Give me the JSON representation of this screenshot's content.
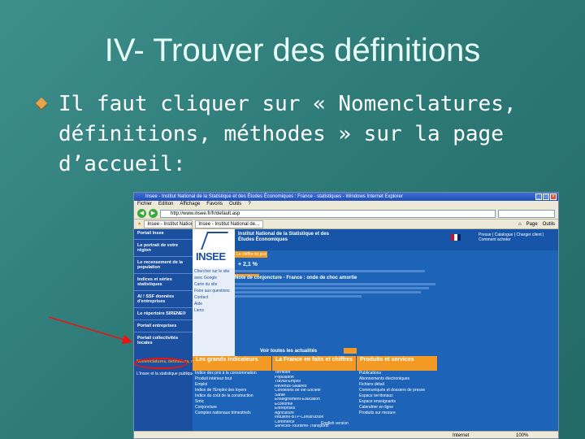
{
  "slide": {
    "title": "IV- Trouver des définitions",
    "bullet_text": "Il faut cliquer sur « Nomenclatures, définitions, méthodes » sur la page d’accueil:"
  },
  "browser": {
    "window_title": "Insee - Institut National de la Statistique et des Études Économiques : France - statistiques - Windows Internet Explorer",
    "menu": [
      "Fichier",
      "Edition",
      "Affichage",
      "Favoris",
      "Outils",
      "?"
    ],
    "url": "http://www.insee.fr/fr/default.asp",
    "tabs": [
      "Insee - Institut National de la...",
      "Insee - Institut National de..."
    ],
    "tools": [
      "Page",
      "Outils"
    ],
    "status_zone": "Internet",
    "zoom": "100%"
  },
  "site": {
    "logo": "INSEE",
    "institute_name": "Institut National de la Statistique et des Études Économiques",
    "chiffre_tag": "Le chiffre du jour",
    "value": "+ 2,1 %",
    "info_tag": "L'info du jour",
    "note_heading": "Note de conjoncture - France : onde de choc amortie",
    "voir_link": "Voir toutes les actualités",
    "voir_tag": "RSS",
    "left_nav": [
      "Portail Insee",
      "Le portrait de votre région",
      "Le recensement de la population",
      "Indices et séries statistiques",
      "Al ! SSF données d'entreprises",
      "Le répertoire SIRENE®",
      "Portail entreprises",
      "Portail collectivités locales"
    ],
    "search_col": [
      "Chercher sur le site",
      "avec Google",
      "Carte du site",
      "Foire aux questions",
      "Contact",
      "Aide",
      "Liens"
    ],
    "highlighted_link": "Nomenclatures, définitions, méthodes",
    "left_links": [
      "Nomenclatures, définitions, méthodes",
      "L'Insee et la statistique publique"
    ],
    "sections": [
      "Les grands indicateurs",
      "La France en faits et chiffres",
      "Produits et services"
    ],
    "col_indicators": [
      "Indice des prix à la consommation",
      "Produit intérieur brut",
      "Emploi",
      "Indice de l'Emploi des loyers",
      "Indice du coût de la construction",
      "Smic",
      "Conjoncture",
      "Comptes nationaux trimestriels"
    ],
    "col_france": [
      "Territoire",
      "Population",
      "Travail-Emploi",
      "Revenus-Salaires",
      "Conditions de vie-Société",
      "Santé",
      "Enseignement-Éducation",
      "Économie",
      "Entreprises",
      "Agriculture",
      "Industrie-BTP-Construction",
      "Commerce",
      "Services-Tourisme-Transports"
    ],
    "col_products": [
      "Publications",
      "Abonnements électroniques",
      "Fichiers détail",
      "Communiqués et dossiers de presse",
      "Espace territoriaux",
      "Espace enseignants",
      "Calendrier en ligne",
      "Produits sur mesure"
    ],
    "footer_links": [
      "English version",
      "Presse | Catalogue | Charger client | Comment acheter"
    ]
  }
}
